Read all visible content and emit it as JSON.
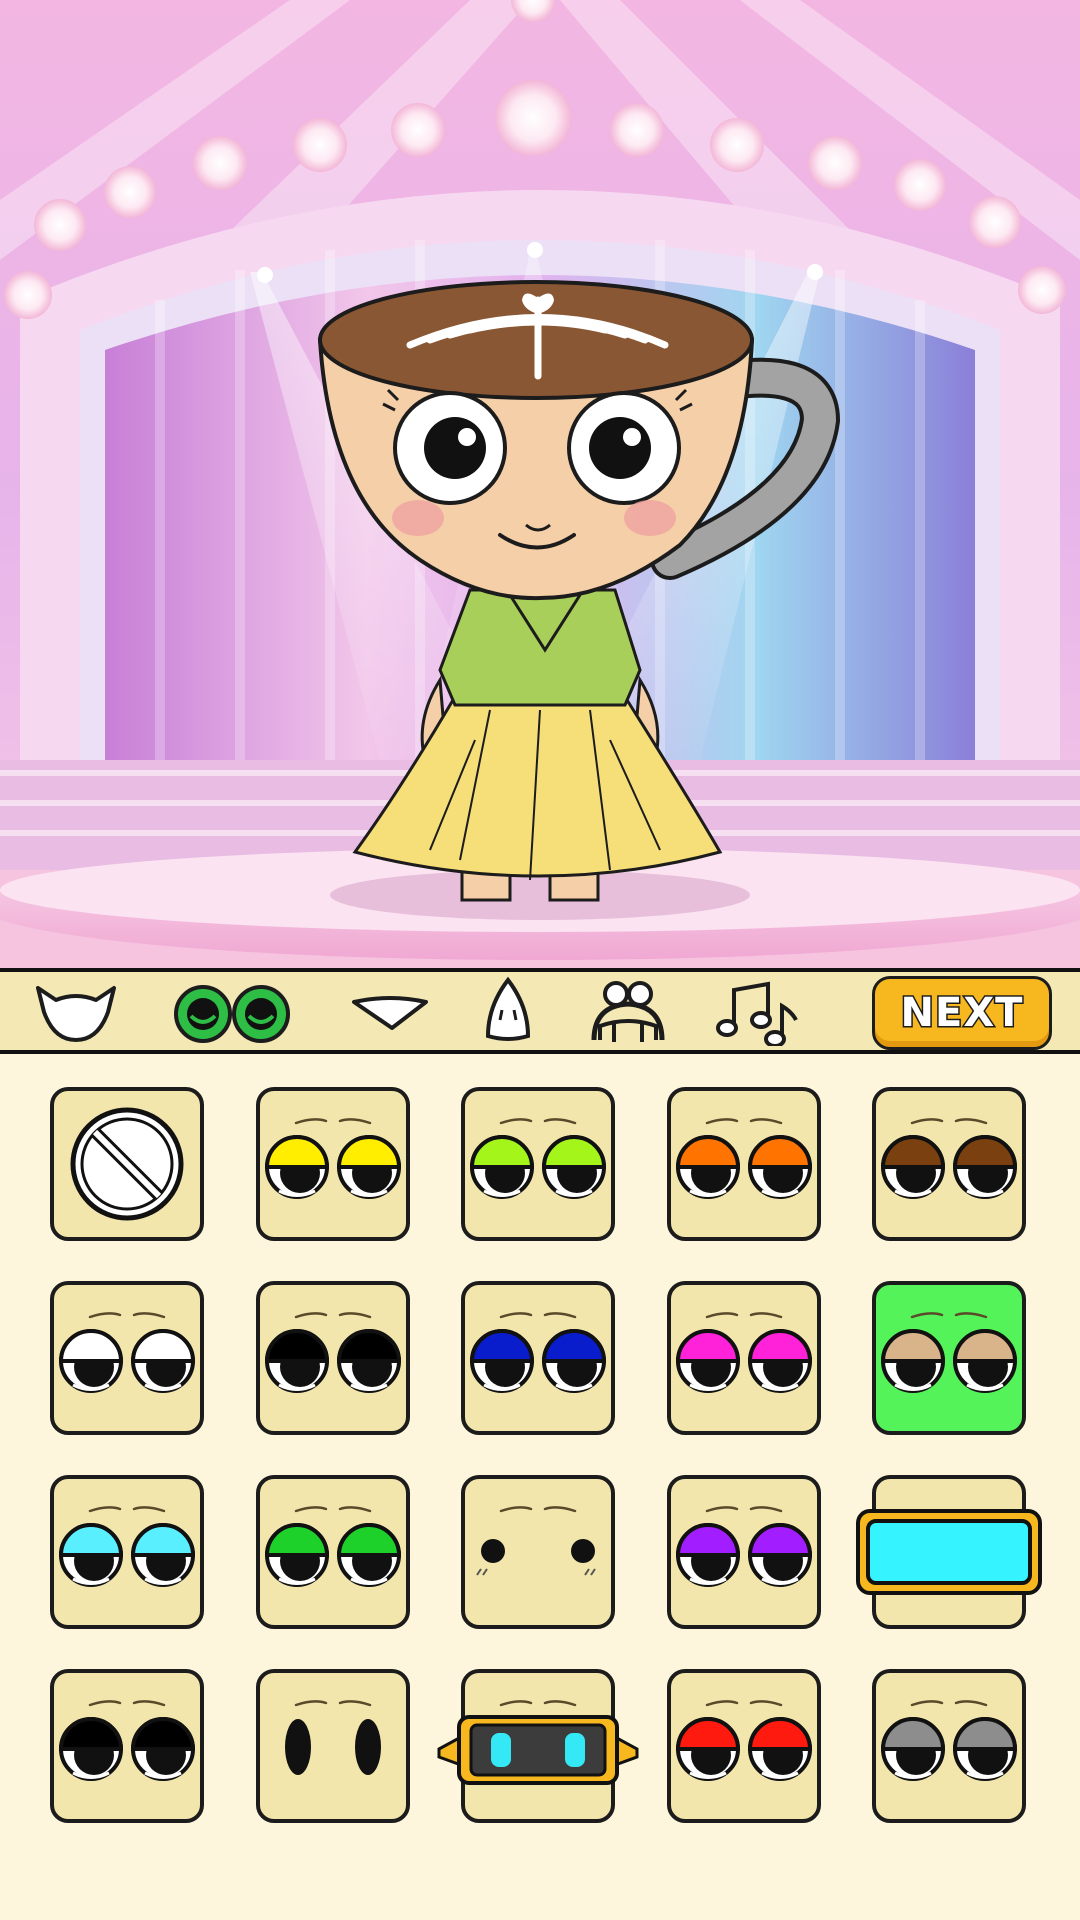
{
  "toolbar": {
    "tabs": [
      {
        "name": "tab-head",
        "icon": "head-shape-icon"
      },
      {
        "name": "tab-eyes",
        "icon": "eyes-icon",
        "selected": true
      },
      {
        "name": "tab-mouth",
        "icon": "mouth-icon"
      },
      {
        "name": "tab-nose",
        "icon": "nose-icon"
      },
      {
        "name": "tab-hair",
        "icon": "hair-icon"
      },
      {
        "name": "tab-music",
        "icon": "music-notes-icon"
      }
    ],
    "next_label": "NEXT"
  },
  "colors": {
    "tile": "#f3e6ac",
    "tile_border": "#1c1c1c",
    "panel_bg": "#fdf6dc",
    "toolbar_bg": "#f4e8b4",
    "next_button": "#f7b81f",
    "selected_tab": "#2ebd45"
  },
  "eye_options": [
    {
      "type": "none",
      "icon": "no-symbol-icon"
    },
    {
      "type": "sleepy",
      "lid": "#ffee00"
    },
    {
      "type": "sleepy",
      "lid": "#a4f51a"
    },
    {
      "type": "sleepy",
      "lid": "#ff7300"
    },
    {
      "type": "sleepy",
      "lid": "#7a4010"
    },
    {
      "type": "sleepy",
      "lid": "#ffffff"
    },
    {
      "type": "sleepy",
      "lid": "#000000"
    },
    {
      "type": "sleepy",
      "lid": "#0a1dcc"
    },
    {
      "type": "sleepy",
      "lid": "#ff22d8"
    },
    {
      "type": "sleepy",
      "lid": "#d9b48a",
      "tile": "#55f35a"
    },
    {
      "type": "sleepy",
      "lid": "#5aefff"
    },
    {
      "type": "sleepy",
      "lid": "#1ed12a"
    },
    {
      "type": "dots"
    },
    {
      "type": "sleepy",
      "lid": "#a21dff"
    },
    {
      "type": "visor",
      "screen": "#35f3ff"
    },
    {
      "type": "sleepy",
      "lid": "#000000"
    },
    {
      "type": "ovals"
    },
    {
      "type": "robot",
      "light": "#35e8f5"
    },
    {
      "type": "sleepy",
      "lid": "#ff1a10"
    },
    {
      "type": "sleepy",
      "lid": "#8d8d8d"
    }
  ]
}
